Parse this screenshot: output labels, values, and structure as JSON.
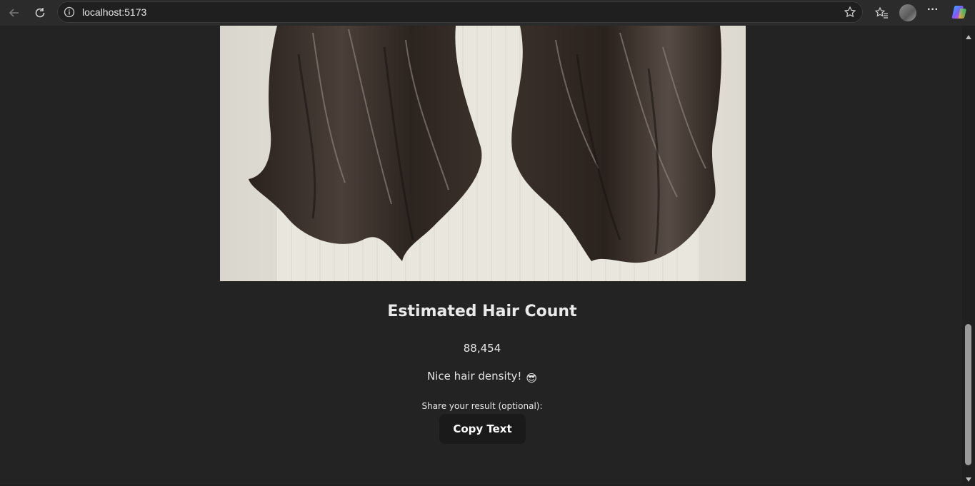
{
  "browser": {
    "url": "localhost:5173",
    "icons": [
      "back-icon",
      "refresh-icon",
      "info-icon",
      "star-icon",
      "favorites-icon",
      "profile-avatar",
      "more-icon",
      "copilot-icon"
    ]
  },
  "result": {
    "title": "Estimated Hair Count",
    "count": "88,454",
    "message": "Nice hair density!",
    "emoji": "😎",
    "share_label": "Share your result (optional):",
    "copy_button": "Copy Text"
  },
  "colors": {
    "page_background": "#232323",
    "text": "#e6e6e6",
    "button_background": "#1a1a1a"
  }
}
